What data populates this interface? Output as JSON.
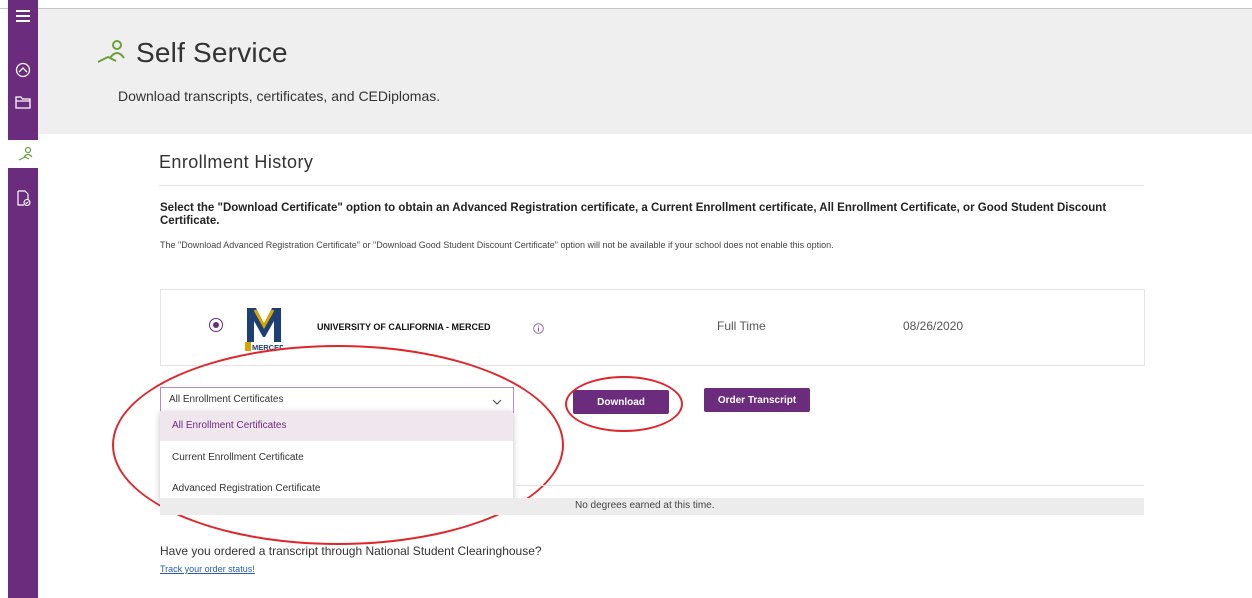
{
  "sidebar": {
    "items": [
      {
        "icon": "menu-icon"
      },
      {
        "icon": "dashboard-icon"
      },
      {
        "icon": "folder-icon"
      },
      {
        "icon": "self-service-icon",
        "active": true
      },
      {
        "icon": "document-check-icon"
      }
    ]
  },
  "header": {
    "title": "Self Service",
    "subtitle": "Download transcripts, certificates, and CEDiplomas."
  },
  "section": {
    "title": "Enrollment History",
    "instruction_bold": "Select the \"Download Certificate\" option to obtain an Advanced Registration certificate, a Current Enrollment certificate, All Enrollment Certificate, or Good Student Discount Certificate.",
    "instruction_small": "The \"Download Advanced Registration Certificate\" or \"Download Good Student Discount Certificate\" option will not be available if your school does not enable this option."
  },
  "enrollment": {
    "school": "UNIVERSITY OF CALIFORNIA - MERCED",
    "logo_text": "UCMERCED",
    "status": "Full Time",
    "date": "08/26/2020"
  },
  "certificate_select": {
    "selected": "All Enrollment Certificates",
    "options": [
      "All Enrollment Certificates",
      "Current Enrollment Certificate",
      "Advanced Registration Certificate"
    ]
  },
  "buttons": {
    "download": "Download",
    "order_transcript": "Order Transcript"
  },
  "degrees": {
    "empty_text": "No degrees earned at this time."
  },
  "footer": {
    "question": "Have you ordered a transcript through National Student Clearinghouse?",
    "track_link": "Track your order status!"
  },
  "colors": {
    "brand_purple": "#6b2c7e",
    "annotation_red": "#e0262b",
    "header_gray": "#efefef"
  }
}
